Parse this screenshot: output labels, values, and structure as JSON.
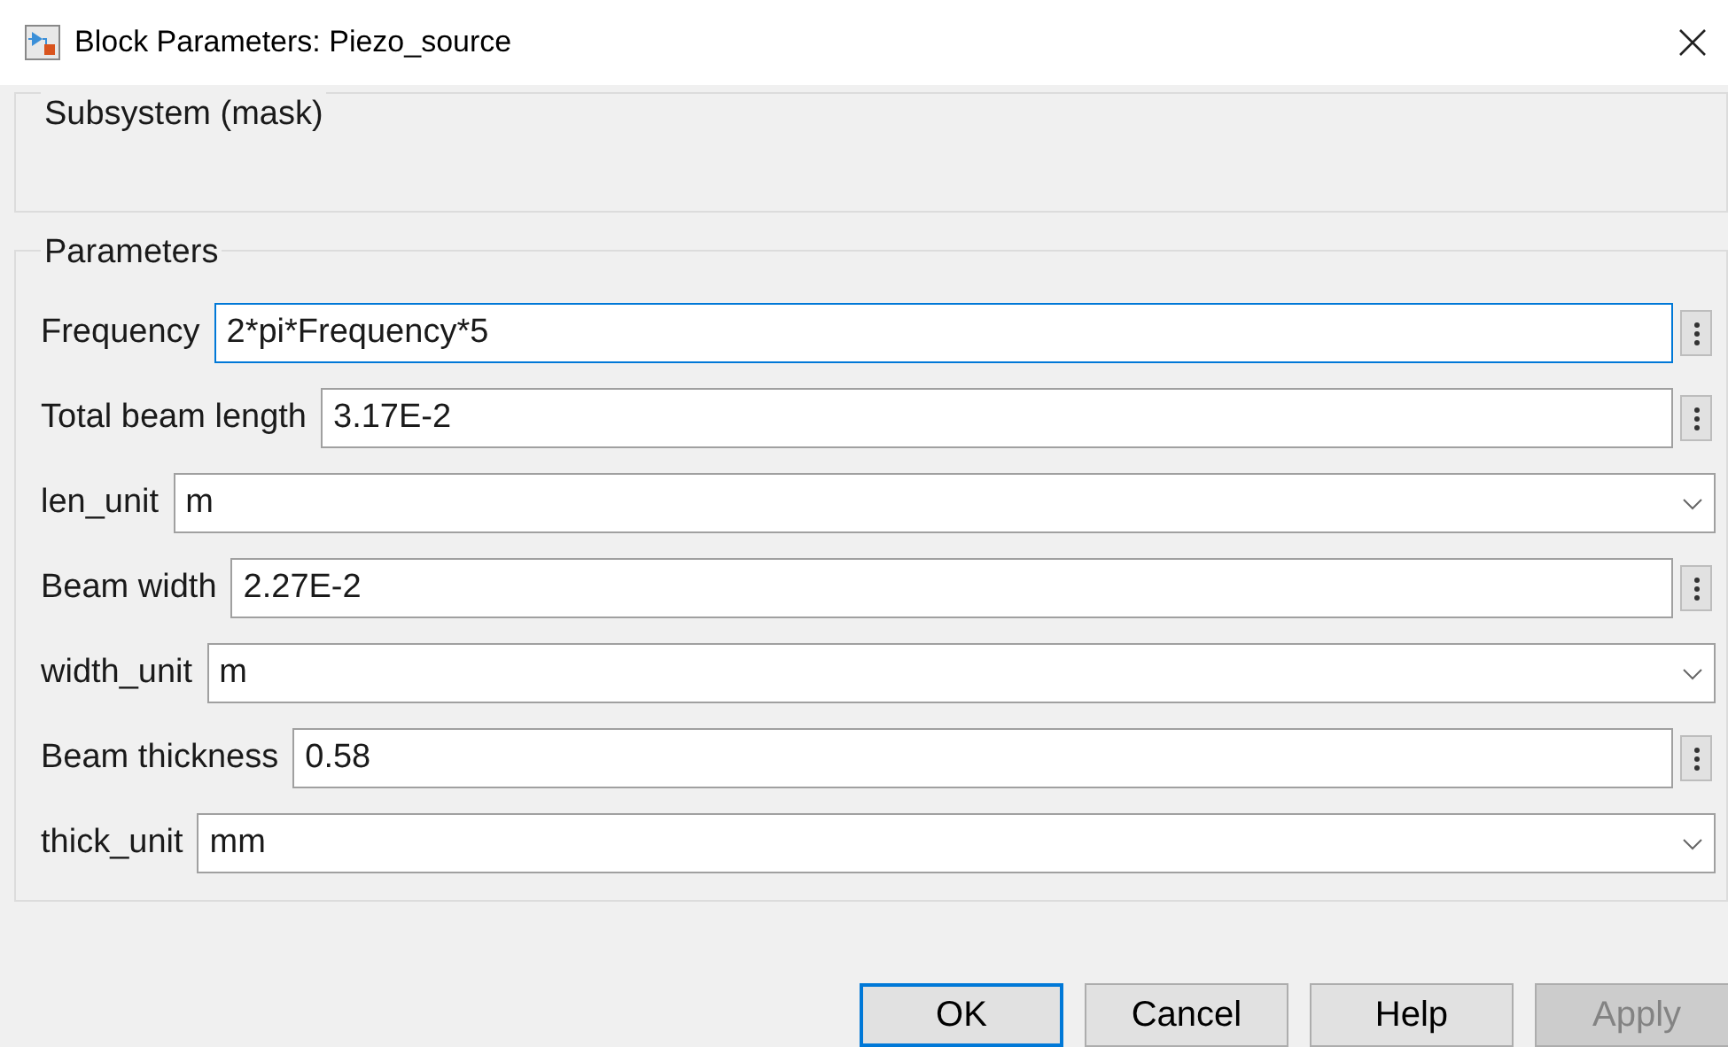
{
  "window": {
    "title": "Block Parameters: Piezo_source"
  },
  "mask_group": {
    "title": "Subsystem (mask)"
  },
  "parameters_group": {
    "title": "Parameters",
    "rows": [
      {
        "kind": "edit",
        "label": "Frequency",
        "value": "2*pi*Frequency*5",
        "focused": true
      },
      {
        "kind": "edit",
        "label": "Total beam length",
        "value": "3.17E-2",
        "focused": false
      },
      {
        "kind": "popup",
        "label": "len_unit",
        "value": "m",
        "focused": false
      },
      {
        "kind": "edit",
        "label": "Beam width",
        "value": "2.27E-2",
        "focused": false
      },
      {
        "kind": "popup",
        "label": "width_unit",
        "value": "m",
        "focused": false
      },
      {
        "kind": "edit",
        "label": "Beam thickness",
        "value": "0.58",
        "focused": false
      },
      {
        "kind": "popup",
        "label": "thick_unit",
        "value": "mm",
        "focused": false
      }
    ]
  },
  "buttons": [
    {
      "label": "OK",
      "default": true,
      "disabled": false
    },
    {
      "label": "Cancel",
      "default": false,
      "disabled": false
    },
    {
      "label": "Help",
      "default": false,
      "disabled": false
    },
    {
      "label": "Apply",
      "default": false,
      "disabled": true
    }
  ]
}
